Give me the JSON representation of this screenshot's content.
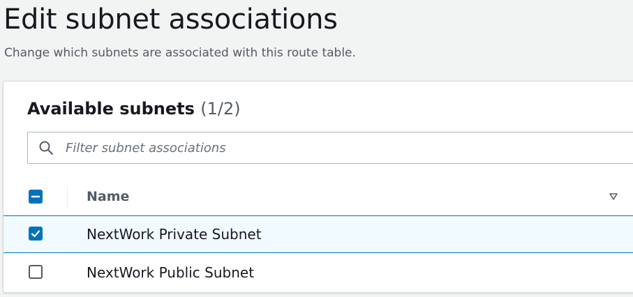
{
  "page": {
    "title": "Edit subnet associations",
    "description": "Change which subnets are associated with this route table."
  },
  "panel": {
    "title": "Available subnets",
    "count": "(1/2)",
    "filter": {
      "placeholder": "Filter subnet associations",
      "value": "",
      "icon": "search-icon"
    },
    "select_all_state": "indeterminate",
    "columns": [
      {
        "label": "Name",
        "sort_icon": "sort-descending-icon"
      }
    ],
    "rows": [
      {
        "name": "NextWork Private Subnet",
        "selected": true
      },
      {
        "name": "NextWork Public Subnet",
        "selected": false
      }
    ]
  },
  "colors": {
    "accent": "#0073bb",
    "selected_row_bg": "#f1faff",
    "page_bg": "#f2f3f3"
  }
}
